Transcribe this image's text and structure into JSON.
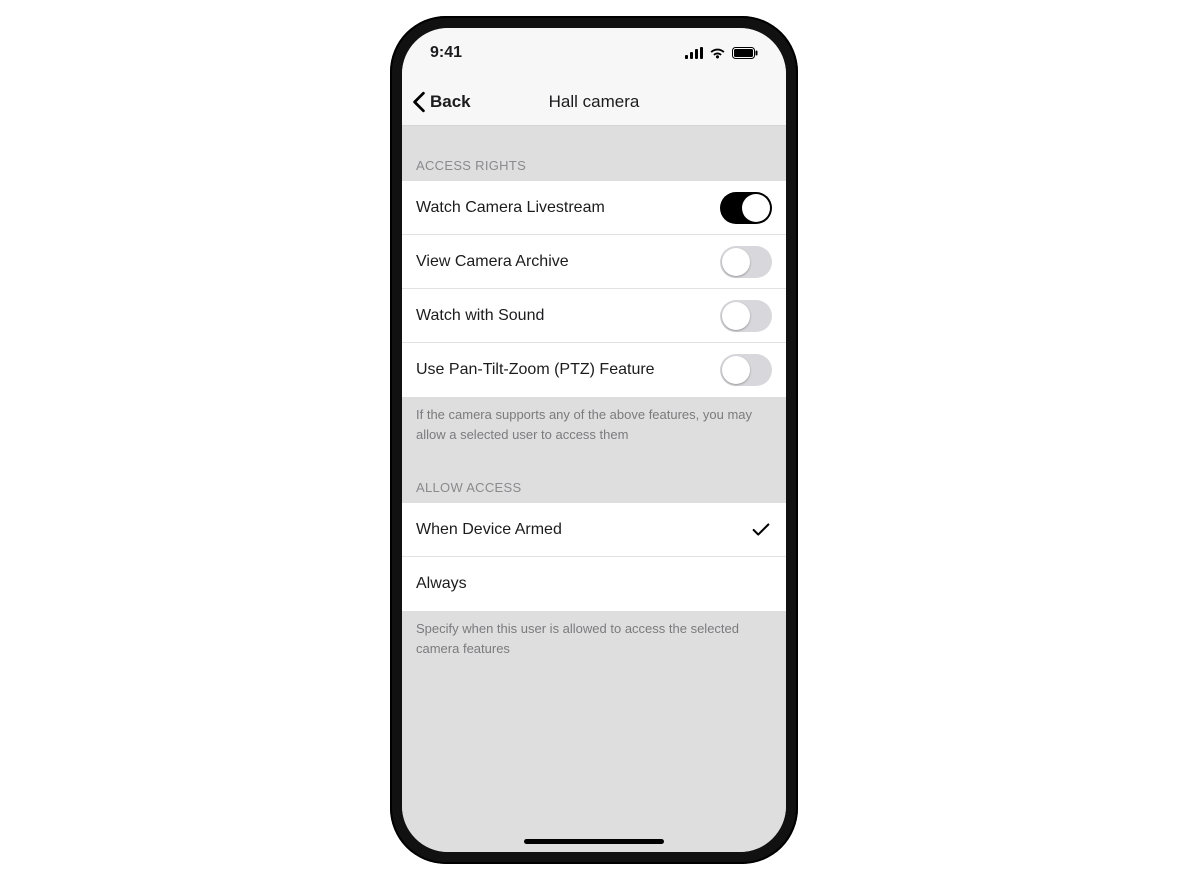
{
  "statusbar": {
    "time": "9:41"
  },
  "nav": {
    "back": "Back",
    "title": "Hall camera"
  },
  "sections": {
    "access_rights": {
      "header": "ACCESS RIGHTS",
      "rows": {
        "livestream": {
          "label": "Watch Camera Livestream",
          "on": true
        },
        "archive": {
          "label": "View Camera Archive",
          "on": false
        },
        "sound": {
          "label": "Watch with Sound",
          "on": false
        },
        "ptz": {
          "label": "Use Pan-Tilt-Zoom (PTZ) Feature",
          "on": false
        }
      },
      "footer": "If the camera supports any of the above features, you may allow a selected user to access them"
    },
    "allow_access": {
      "header": "ALLOW ACCESS",
      "rows": {
        "when_armed": {
          "label": "When Device Armed",
          "selected": true
        },
        "always": {
          "label": "Always",
          "selected": false
        }
      },
      "footer": "Specify when this user is allowed to access the selected camera features"
    }
  }
}
